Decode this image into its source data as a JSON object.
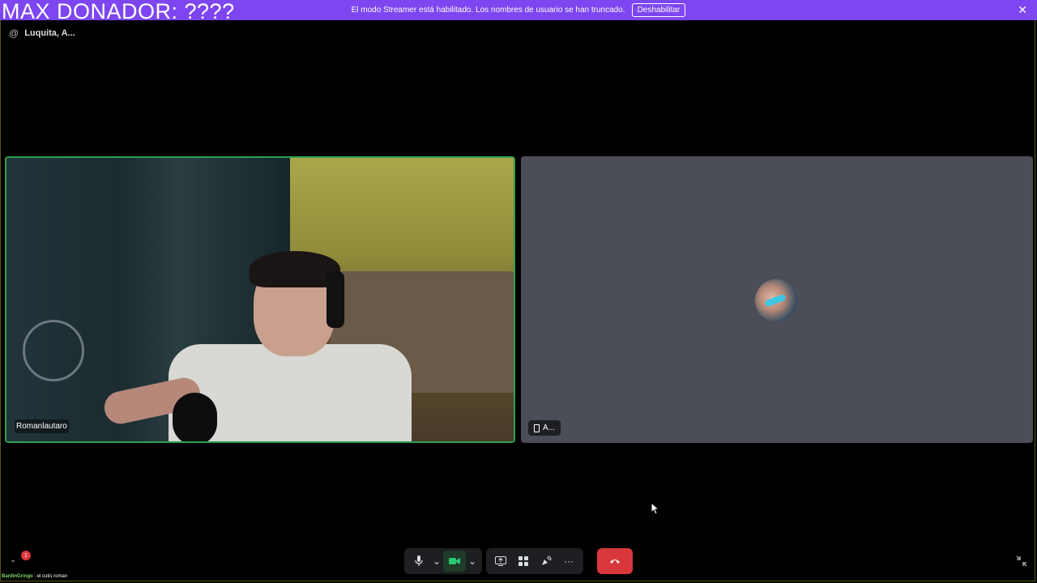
{
  "overlay": {
    "title": "MAX DONADOR: ????"
  },
  "banner": {
    "text": "El modo Streamer está habilitado. Los nombres de usuario se han truncado.",
    "button_label": "Deshabilitar",
    "close_glyph": "✕"
  },
  "channel": {
    "prefix": "@",
    "name": "Luquita, A..."
  },
  "participants": [
    {
      "name": "Romanlautaro",
      "video": true,
      "speaking": true
    },
    {
      "name": "A...",
      "video": false,
      "device": "phone-icon"
    }
  ],
  "controls": {
    "mic_icon": "🎙",
    "chevron": "⌄",
    "camera_icon": "■",
    "screen_share_icon": "⧉",
    "activities_icon": "✣",
    "soundboard_icon": "♪",
    "more_icon": "···",
    "leave_icon": "☎"
  },
  "bottom": {
    "notification_count": "1",
    "expand_glyph": "⌄",
    "fullscreen_glyph": "⤡"
  },
  "chat": {
    "user": "BardinGringo",
    "separator": " : ",
    "message": "el cutis roman"
  },
  "colors": {
    "banner": "#7d46f0",
    "speaking_border": "#2fa04f",
    "leave": "#da373c"
  }
}
